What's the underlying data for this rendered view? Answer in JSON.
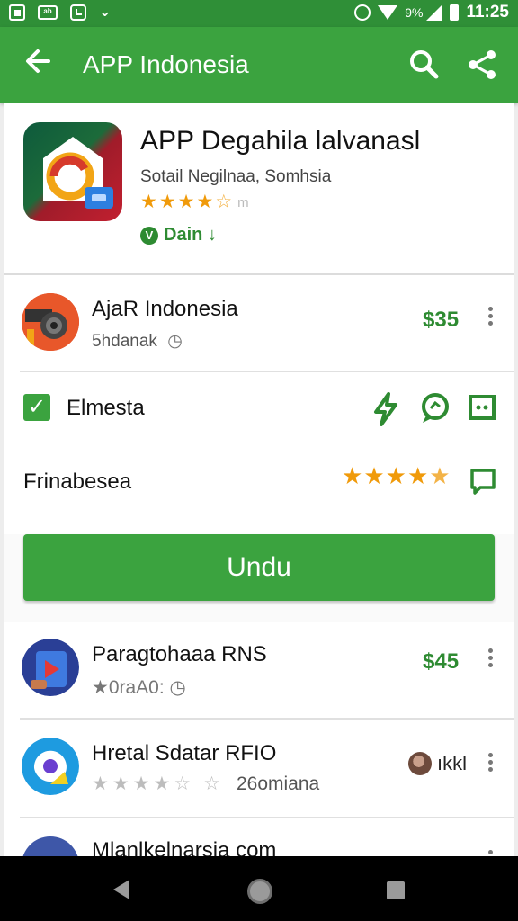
{
  "status_bar": {
    "notif_msg_label": "ab",
    "battery_pct": "9%",
    "time": "11:25"
  },
  "app_bar": {
    "title": "APP Indonesia",
    "back_icon": "arrow-left-icon",
    "search_icon": "search-icon",
    "share_icon": "share-icon",
    "color": "#3ba33f",
    "status_color": "#2f8f37"
  },
  "app": {
    "title": "APP Degahila lalvanasl",
    "developer": "Sotail Negilnaa, Somhsia",
    "stars": 4.5,
    "rating_count": "m",
    "badge_text": "Dain ↓",
    "badge_letter": "V"
  },
  "list": [
    {
      "title": "AjaR Indonesia",
      "subtitle": "5hdanak",
      "price": "$35"
    }
  ],
  "feature_row": {
    "label": "Elmesta"
  },
  "rating_row": {
    "label": "Frinabesea",
    "stars": 4.5
  },
  "install_button": {
    "label": "Undu"
  },
  "related": [
    {
      "title": "Paragtohaaa RNS",
      "subtitle": "★0raA0: ◷",
      "price": "$45"
    },
    {
      "title": "Hretal Sdatar RFIO",
      "subtitle": "26omiana",
      "price": "ıkkl",
      "stars": 4
    },
    {
      "title": "Mlanlkelnarsia com"
    }
  ],
  "accent_green": "#2e8b32",
  "star_color": "#f09a0a"
}
